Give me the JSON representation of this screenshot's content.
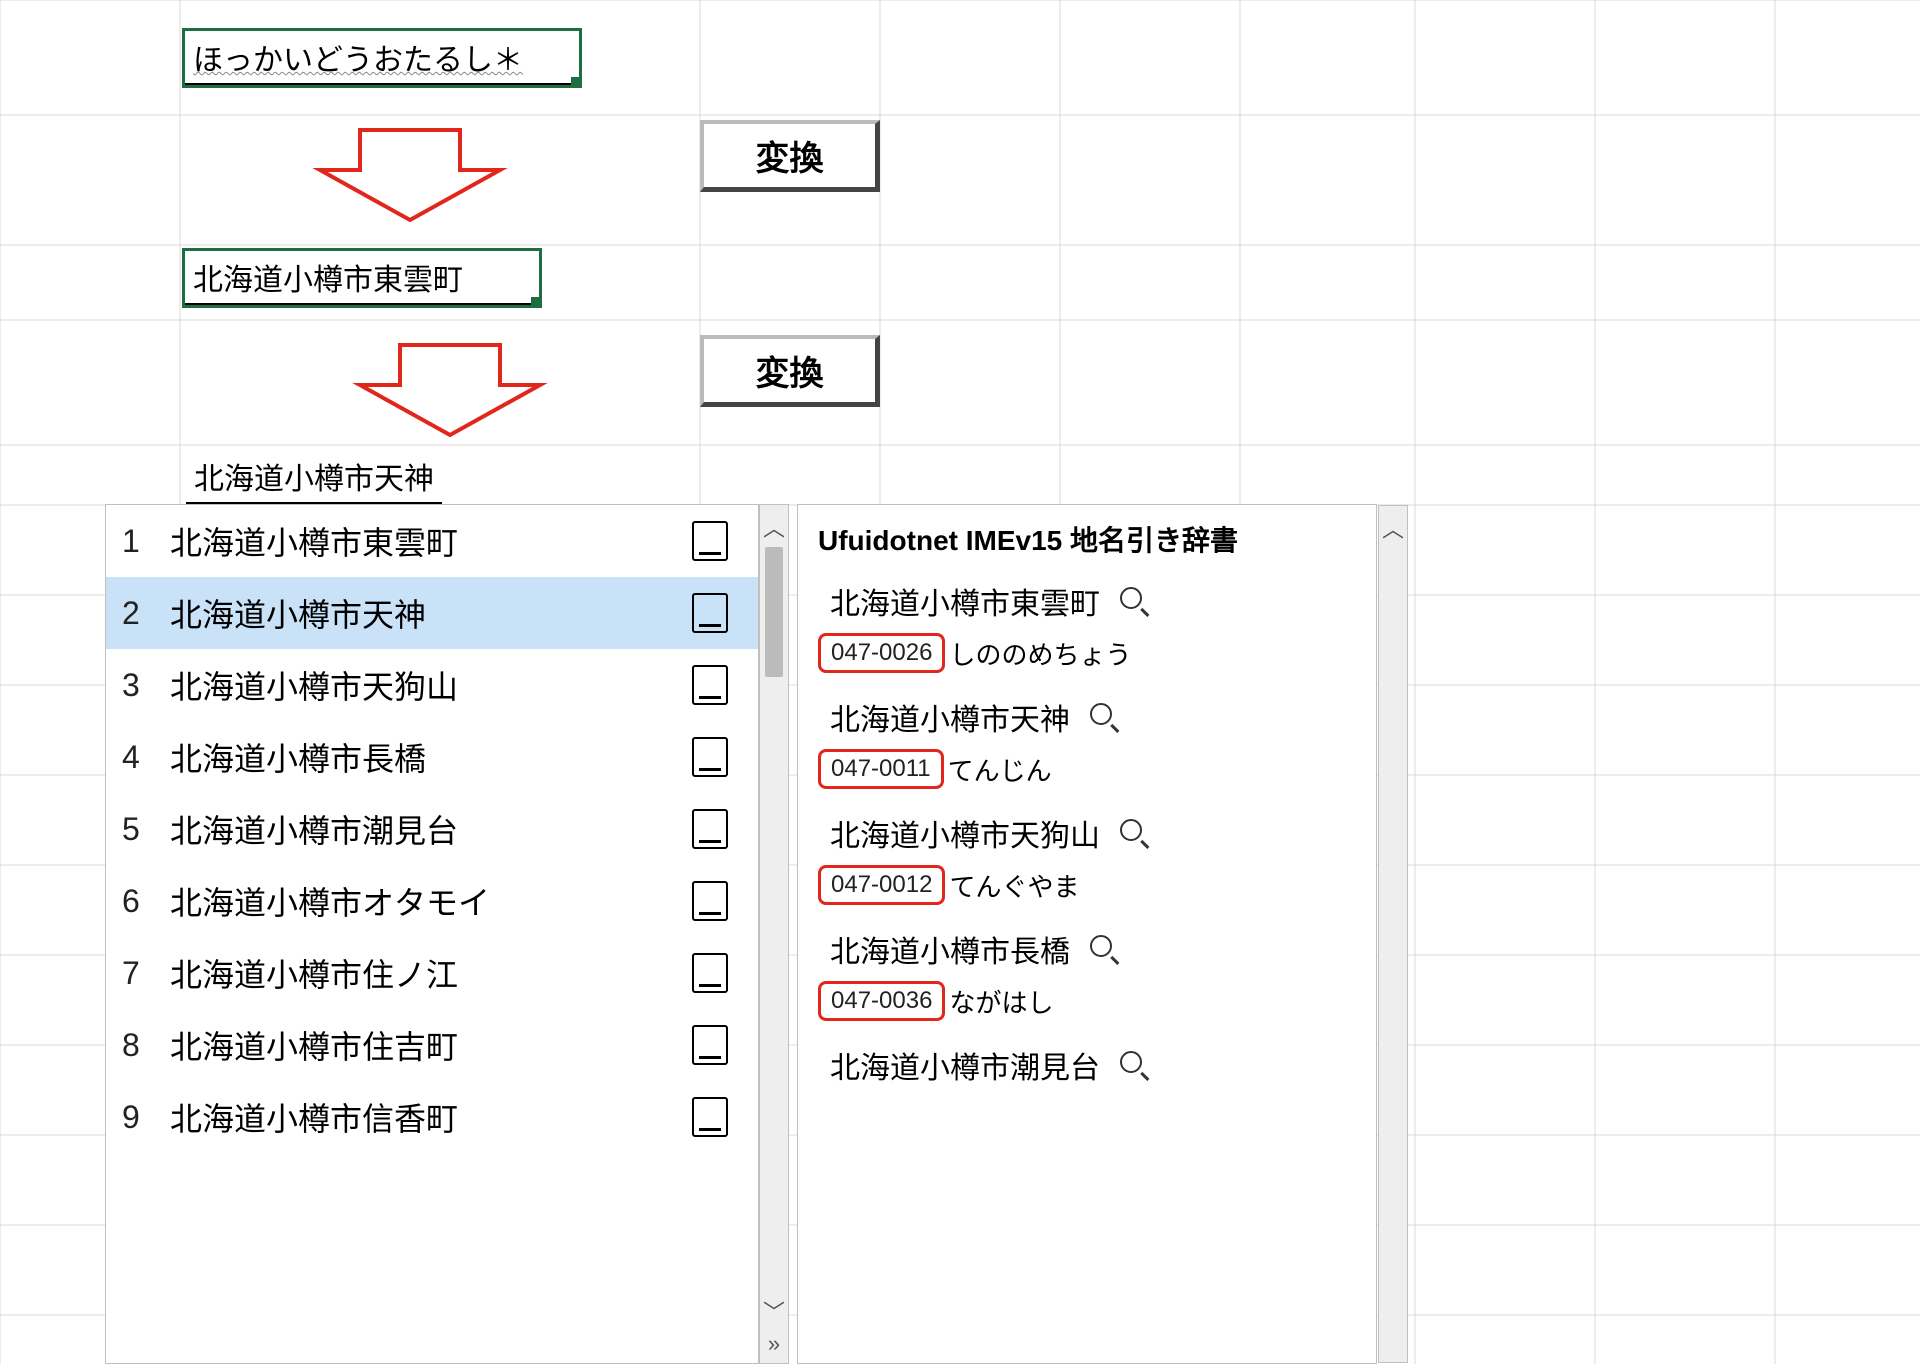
{
  "cells": {
    "input1": "ほっかいどうおたるし＊",
    "input2": "北海道小樽市東雲町",
    "input3": "北海道小樽市天神"
  },
  "button_label": "変換",
  "candidates": [
    {
      "num": "1",
      "text": "北海道小樽市東雲町",
      "selected": false
    },
    {
      "num": "2",
      "text": "北海道小樽市天神",
      "selected": true
    },
    {
      "num": "3",
      "text": "北海道小樽市天狗山",
      "selected": false
    },
    {
      "num": "4",
      "text": "北海道小樽市長橋",
      "selected": false
    },
    {
      "num": "5",
      "text": "北海道小樽市潮見台",
      "selected": false
    },
    {
      "num": "6",
      "text": "北海道小樽市オタモイ",
      "selected": false
    },
    {
      "num": "7",
      "text": "北海道小樽市住ノ江",
      "selected": false
    },
    {
      "num": "8",
      "text": "北海道小樽市住吉町",
      "selected": false
    },
    {
      "num": "9",
      "text": "北海道小樽市信香町",
      "selected": false
    }
  ],
  "dictionary": {
    "title": "Ufuidotnet IMEv15 地名引き辞書",
    "entries": [
      {
        "place": "北海道小樽市東雲町",
        "postal": "047-0026",
        "reading": "しののめちょう"
      },
      {
        "place": "北海道小樽市天神",
        "postal": "047-0011",
        "reading": "てんじん"
      },
      {
        "place": "北海道小樽市天狗山",
        "postal": "047-0012",
        "reading": "てんぐやま"
      },
      {
        "place": "北海道小樽市長橋",
        "postal": "047-0036",
        "reading": "ながはし"
      },
      {
        "place": "北海道小樽市潮見台",
        "postal": "",
        "reading": ""
      }
    ]
  }
}
